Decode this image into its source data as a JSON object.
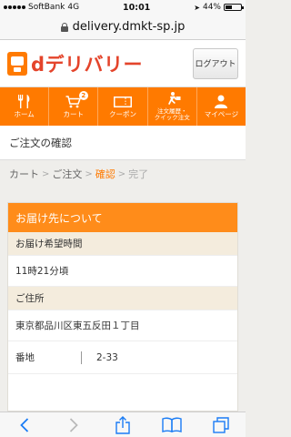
{
  "status_bar": {
    "carrier": "SoftBank",
    "network": "4G",
    "time": "10:01",
    "battery": "44%",
    "battery_level": 0.44
  },
  "browser": {
    "url": "delivery.dmkt-sp.jp"
  },
  "site": {
    "logo_text": "dデリバリー",
    "logout_label": "ログアウト",
    "accent_color": "#ff7a00"
  },
  "nav": {
    "home": "ホーム",
    "cart": "カート",
    "cart_count": "2",
    "coupon": "クーポン",
    "history_line1": "注文履歴・",
    "history_line2": "クイック注文",
    "mypage": "マイページ"
  },
  "page": {
    "title": "ご注文の確認"
  },
  "breadcrumb": {
    "step1": "カート",
    "step2": "ご注文",
    "step3": "確認",
    "step4": "完了",
    "separator": ">"
  },
  "delivery": {
    "heading": "お届け先について",
    "time_label": "お届け希望時間",
    "time_value": "11時21分頃",
    "address_label": "ご住所",
    "address_value": "東京都品川区東五反田１丁目",
    "banchi_label": "番地",
    "banchi_value": "2-33"
  }
}
